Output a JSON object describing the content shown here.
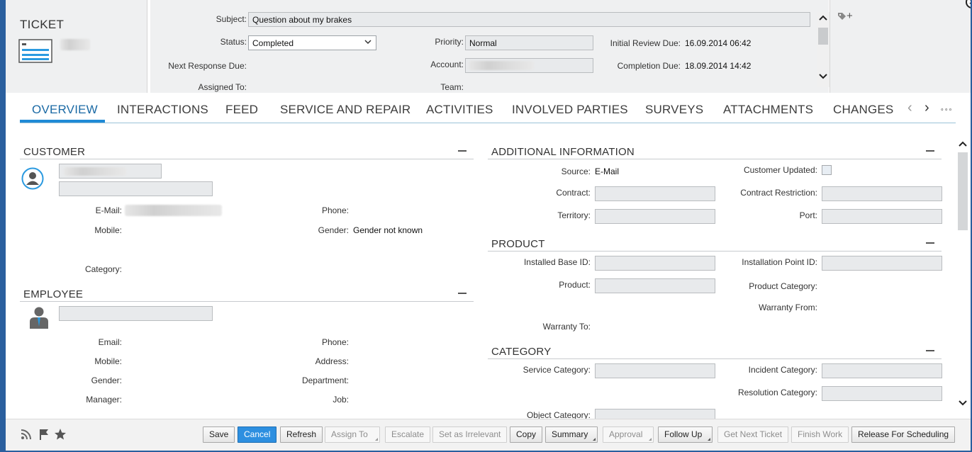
{
  "header": {
    "object_type": "TICKET",
    "subject_label": "Subject:",
    "subject_value": "Question about my brakes",
    "status_label": "Status:",
    "status_value": "Completed",
    "priority_label": "Priority:",
    "priority_value": "Normal",
    "initial_review_label": "Initial Review Due:",
    "initial_review_value": "16.09.2014 06:42",
    "next_response_label": "Next Response Due:",
    "account_label": "Account:",
    "completion_label": "Completion Due:",
    "completion_value": "18.09.2014 14:42",
    "assigned_label": "Assigned To:",
    "team_label": "Team:",
    "tag_add_label": "+"
  },
  "tabs": [
    {
      "label": "OVERVIEW"
    },
    {
      "label": "INTERACTIONS"
    },
    {
      "label": "FEED"
    },
    {
      "label": "SERVICE AND REPAIR"
    },
    {
      "label": "ACTIVITIES"
    },
    {
      "label": "INVOLVED PARTIES"
    },
    {
      "label": "SURVEYS"
    },
    {
      "label": "ATTACHMENTS"
    },
    {
      "label": "CHANGES"
    }
  ],
  "tab_nav": {
    "prev": "‹",
    "next": "›",
    "more": "∘∘∘"
  },
  "customer": {
    "title": "CUSTOMER",
    "email_label": "E-Mail:",
    "phone_label": "Phone:",
    "mobile_label": "Mobile:",
    "gender_label": "Gender:",
    "gender_value": "Gender not known",
    "category_label": "Category:"
  },
  "employee": {
    "title": "EMPLOYEE",
    "email_label": "Email:",
    "phone_label": "Phone:",
    "mobile_label": "Mobile:",
    "address_label": "Address:",
    "gender_label": "Gender:",
    "department_label": "Department:",
    "manager_label": "Manager:",
    "job_label": "Job:"
  },
  "additional": {
    "title": "ADDITIONAL INFORMATION",
    "source_label": "Source:",
    "source_value": "E-Mail",
    "customer_updated_label": "Customer Updated:",
    "contract_label": "Contract:",
    "contract_restriction_label": "Contract Restriction:",
    "territory_label": "Territory:",
    "port_label": "Port:"
  },
  "product": {
    "title": "PRODUCT",
    "installed_base_label": "Installed Base ID:",
    "installation_point_label": "Installation Point ID:",
    "product_label": "Product:",
    "product_category_label": "Product Category:",
    "warranty_from_label": "Warranty From:",
    "warranty_to_label": "Warranty To:"
  },
  "category": {
    "title": "CATEGORY",
    "service_category_label": "Service Category:",
    "incident_category_label": "Incident Category:",
    "resolution_category_label": "Resolution Category:",
    "object_category_label": "Object Category:"
  },
  "footer": {
    "save": "Save",
    "cancel": "Cancel",
    "refresh": "Refresh",
    "assign_to": "Assign To",
    "escalate": "Escalate",
    "set_irrelevant": "Set as Irrelevant",
    "copy": "Copy",
    "summary": "Summary",
    "approval": "Approval",
    "follow_up": "Follow Up",
    "get_next_ticket": "Get Next Ticket",
    "finish_work": "Finish Work",
    "release_for_scheduling": "Release For Scheduling"
  },
  "colors": {
    "accent": "#1f8ad6",
    "primary_button": "#2d8fe0",
    "header_bg": "#eff0f1"
  }
}
